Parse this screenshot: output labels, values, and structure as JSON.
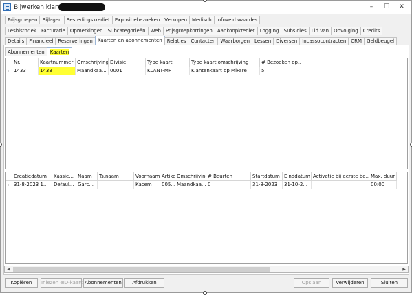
{
  "window": {
    "title": "Bijwerken klant -",
    "min": "–",
    "max": "☐",
    "close": "✕"
  },
  "tab_rows": [
    [
      "Prijsgroepen",
      "Bijlagen",
      "Bestedingskrediet",
      "Expositiebezoeken",
      "Verkopen",
      "Medisch",
      "Infoveld waardes"
    ],
    [
      "Leshistoriek",
      "Facturatie",
      "Opmerkingen",
      "Subcategorieën",
      "Web",
      "Prijsgroepkortingen",
      "Aankoopkrediet",
      "Logging",
      "Subsidies",
      "Lid van",
      "Opvolging",
      "Credits"
    ],
    [
      "Details",
      "Financieel",
      "Reserveringen",
      "Kaarten en abonnementen",
      "Relaties",
      "Contacten",
      "Waarborgen",
      "Lessen",
      "Diversen",
      "Incassocontracten",
      "CRM",
      "Geldbeugel"
    ]
  ],
  "active_tab": "Kaarten en abonnementen",
  "subtabs": [
    "Abonnementen",
    "Kaarten"
  ],
  "active_subtab": "Kaarten",
  "cards_grid": {
    "columns": [
      "Nr.",
      "Kaartnummer",
      "Omschrijving",
      "Divisie",
      "Type kaart",
      "Type kaart omschrijving",
      "# Bezoeken op..."
    ],
    "rows": [
      {
        "marker": "▸",
        "cells": [
          "1433",
          "1433",
          "Maandkaa...",
          "0001",
          "KLANT-MF",
          "Klantenkaart op MiFare",
          "5"
        ]
      }
    ]
  },
  "subscriptions_grid": {
    "columns": [
      "Creatiedatum",
      "Kassie...",
      "Naam",
      "Ts.naam",
      "Voornaam",
      "Artikel",
      "Omschrijving",
      "# Beurten",
      "Startdatum",
      "Einddatum",
      "Activatie bij eerste be...",
      "Max. duur b..."
    ],
    "rows": [
      {
        "marker": "▸",
        "cells": [
          "31-8-2023 1...",
          "Defaul...",
          "Garc...",
          "",
          "Kacem",
          "005...",
          "Maandkaa...",
          "0",
          "31-8-2023",
          "31-10-2...",
          "",
          "00:00"
        ],
        "activation_checked": false
      }
    ]
  },
  "buttons": {
    "kopieren": "Kopiëren",
    "inlezen": "Inlezen eID-kaart",
    "abonnementen": "Abonnementen",
    "afdrukken": "Afdrukken",
    "opslaan": "Opslaan",
    "verwijderen": "Verwijderen",
    "sluiten": "Sluiten"
  }
}
